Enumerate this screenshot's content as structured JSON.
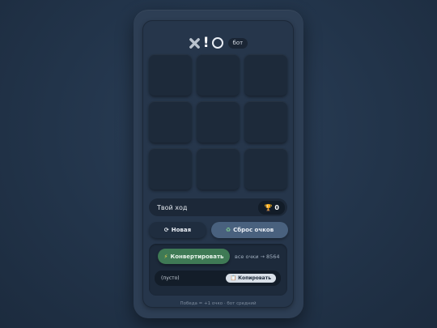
{
  "header": {
    "logo_x_icon": "x-cross-icon",
    "logo_exclaim": "!",
    "logo_o_icon": "circle-icon",
    "mode_badge": "бот"
  },
  "board": {
    "cells": [
      "",
      "",
      "",
      "",
      "",
      "",
      "",
      "",
      ""
    ]
  },
  "status": {
    "text": "Твой ход",
    "trophy_icon": "🏆",
    "score": "0"
  },
  "controls": {
    "new_icon": "⟳",
    "new_label": "Новая",
    "reset_icon": "♻",
    "reset_label": "Сброс очков"
  },
  "convert": {
    "icon": "⚡",
    "label": "Конвертировать",
    "hint": "все очки → 8564",
    "output": "(пусто)",
    "copy_icon": "📋",
    "copy_label": "Копировать"
  },
  "footer": {
    "text": "Победа = +1 очко · бот средний"
  },
  "colors": {
    "background": "#22344a",
    "convert_button": "#3f7a55",
    "reset_button": "#49617e",
    "trophy": "#e8b93a"
  }
}
